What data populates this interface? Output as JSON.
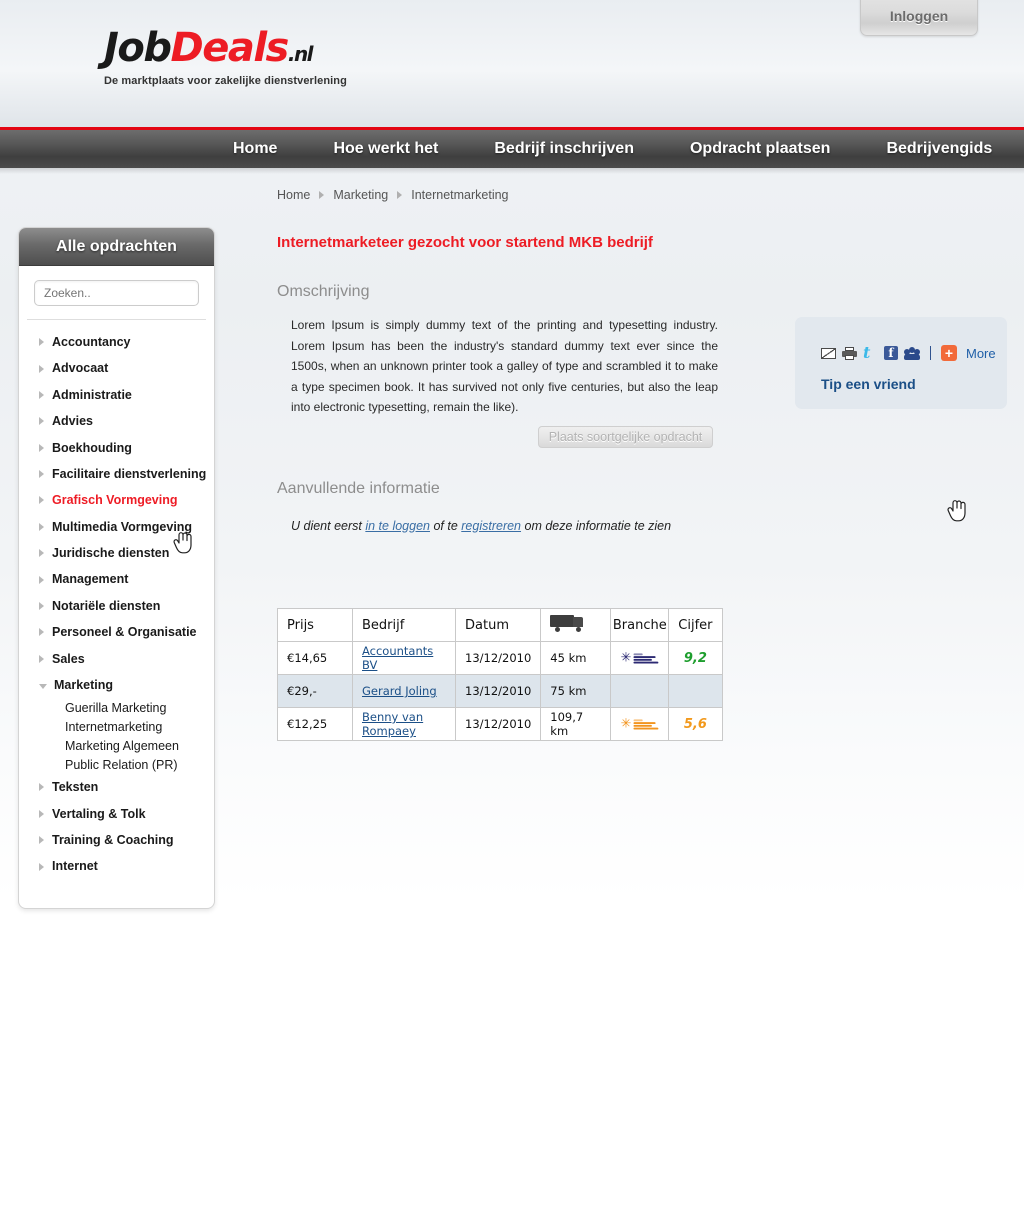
{
  "header": {
    "login_label": "Inloggen",
    "logo": {
      "part1": "Job",
      "part2": "Deals",
      "part3": ".nl"
    },
    "tagline": "De marktplaats voor zakelijke dienstverlening"
  },
  "nav": {
    "items": [
      {
        "label": "Home"
      },
      {
        "label": "Hoe werkt het"
      },
      {
        "label": "Bedrijf inschrijven"
      },
      {
        "label": "Opdracht plaatsen"
      },
      {
        "label": "Bedrijvengids"
      }
    ]
  },
  "sidebar": {
    "title": "Alle opdrachten",
    "search_placeholder": "Zoeken..",
    "search_value": "",
    "categories": [
      {
        "label": "Accountancy",
        "state": "collapsed",
        "active": false
      },
      {
        "label": "Advocaat",
        "state": "collapsed",
        "active": false
      },
      {
        "label": "Administratie",
        "state": "collapsed",
        "active": false
      },
      {
        "label": "Advies",
        "state": "collapsed",
        "active": false
      },
      {
        "label": "Boekhouding",
        "state": "collapsed",
        "active": false
      },
      {
        "label": "Facilitaire dienstverlening",
        "state": "collapsed",
        "active": false
      },
      {
        "label": "Grafisch Vormgeving",
        "state": "collapsed",
        "active": true
      },
      {
        "label": "Multimedia Vormgeving",
        "state": "collapsed",
        "active": false
      },
      {
        "label": "Juridische diensten",
        "state": "collapsed",
        "active": false
      },
      {
        "label": "Management",
        "state": "collapsed",
        "active": false
      },
      {
        "label": "Notariële diensten",
        "state": "collapsed",
        "active": false
      },
      {
        "label": "Personeel & Organisatie",
        "state": "collapsed",
        "active": false
      },
      {
        "label": "Sales",
        "state": "collapsed",
        "active": false
      },
      {
        "label": "Marketing",
        "state": "expanded",
        "active": false,
        "children": [
          {
            "label": "Guerilla Marketing"
          },
          {
            "label": "Internetmarketing"
          },
          {
            "label": "Marketing Algemeen"
          },
          {
            "label": "Public Relation (PR)"
          }
        ]
      },
      {
        "label": "Teksten",
        "state": "collapsed",
        "active": false
      },
      {
        "label": "Vertaling & Tolk",
        "state": "collapsed",
        "active": false
      },
      {
        "label": "Training & Coaching",
        "state": "collapsed",
        "active": false
      },
      {
        "label": "Internet",
        "state": "collapsed",
        "active": false
      }
    ]
  },
  "breadcrumb": [
    {
      "label": "Home"
    },
    {
      "label": "Marketing"
    },
    {
      "label": "Internetmarketing"
    }
  ],
  "main": {
    "title": "Internetmarketeer gezocht voor startend MKB bedrijf",
    "description_heading": "Omschrijving",
    "description_body": "Lorem Ipsum is simply dummy text of the printing and typesetting industry. Lorem Ipsum has been the industry's standard dummy text ever since the 1500s, when an unknown printer took a galley of type and scrambled it to make a type specimen book. It has survived not only five centuries, but also the leap into electronic typesetting, remain the like).",
    "similar_button": "Plaats soortgelijke opdracht",
    "extra_heading": "Aanvullende informatie",
    "extra_note_pre": "U dient eerst ",
    "extra_note_link1": "in te loggen",
    "extra_note_mid": " of te ",
    "extra_note_link2": "registreren",
    "extra_note_post": " om deze informatie te zien"
  },
  "share": {
    "icons": [
      "mail-icon",
      "print-icon",
      "twitter-icon",
      "facebook-icon",
      "myspace-icon",
      "addthis-plus-icon"
    ],
    "more_label": "More",
    "tip_label": "Tip een vriend"
  },
  "table": {
    "headers": [
      "Prijs",
      "Bedrijf",
      "Datum",
      "truck-icon",
      "Branche",
      "Cijfer"
    ],
    "rows": [
      {
        "prijs": "€14,65",
        "bedrijf": "Accountants  BV",
        "datum": "13/12/2010",
        "afstand": "45 km",
        "branche": "branche-logo-blue",
        "cijfer": "9,2",
        "cijfer_color": "#1e9e2e"
      },
      {
        "prijs": "€29,-",
        "bedrijf": "Gerard Joling ",
        "datum": "13/12/2010",
        "afstand": "75 km",
        "branche": "",
        "cijfer": "",
        "cijfer_color": ""
      },
      {
        "prijs": "€12,25",
        "bedrijf": "Benny van Rompaey",
        "datum": "13/12/2010",
        "afstand": "109,7 km",
        "branche": "branche-logo-orange",
        "cijfer": "5,6",
        "cijfer_color": "#f2991c"
      }
    ]
  },
  "colors": {
    "brand_red": "#ed1c24",
    "link_blue": "#1b4f87",
    "nav_dark": "#4e4e4e",
    "share_bg": "#e2e8ee",
    "row_alt": "#dde5ec"
  }
}
